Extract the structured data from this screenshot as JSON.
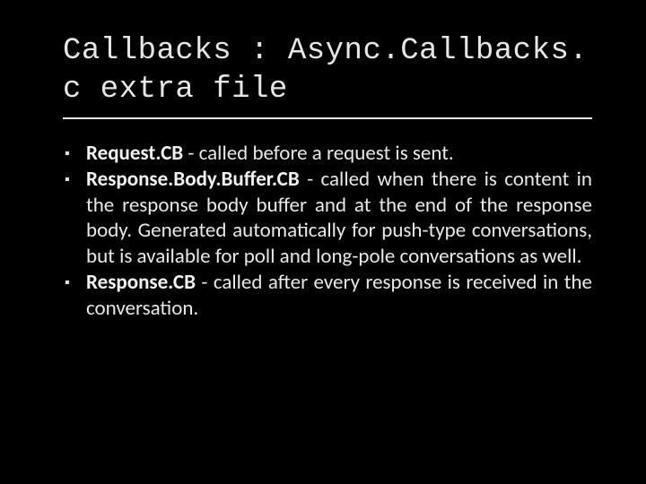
{
  "slide": {
    "title": "Callbacks : Async.Callbacks. c extra file",
    "bullets": [
      {
        "lead": "Request.CB",
        "rest": " - called before a request is sent."
      },
      {
        "lead": "Response.Body.Buffer.CB",
        "rest": " - called when there is content in the response body buffer and at the end of the response body. Generated automatically for push-type conversations, but is available for poll and long-pole conversations as well."
      },
      {
        "lead": "Response.CB",
        "rest": " - called after every response is received in the conversation."
      }
    ],
    "marker": "▪"
  }
}
